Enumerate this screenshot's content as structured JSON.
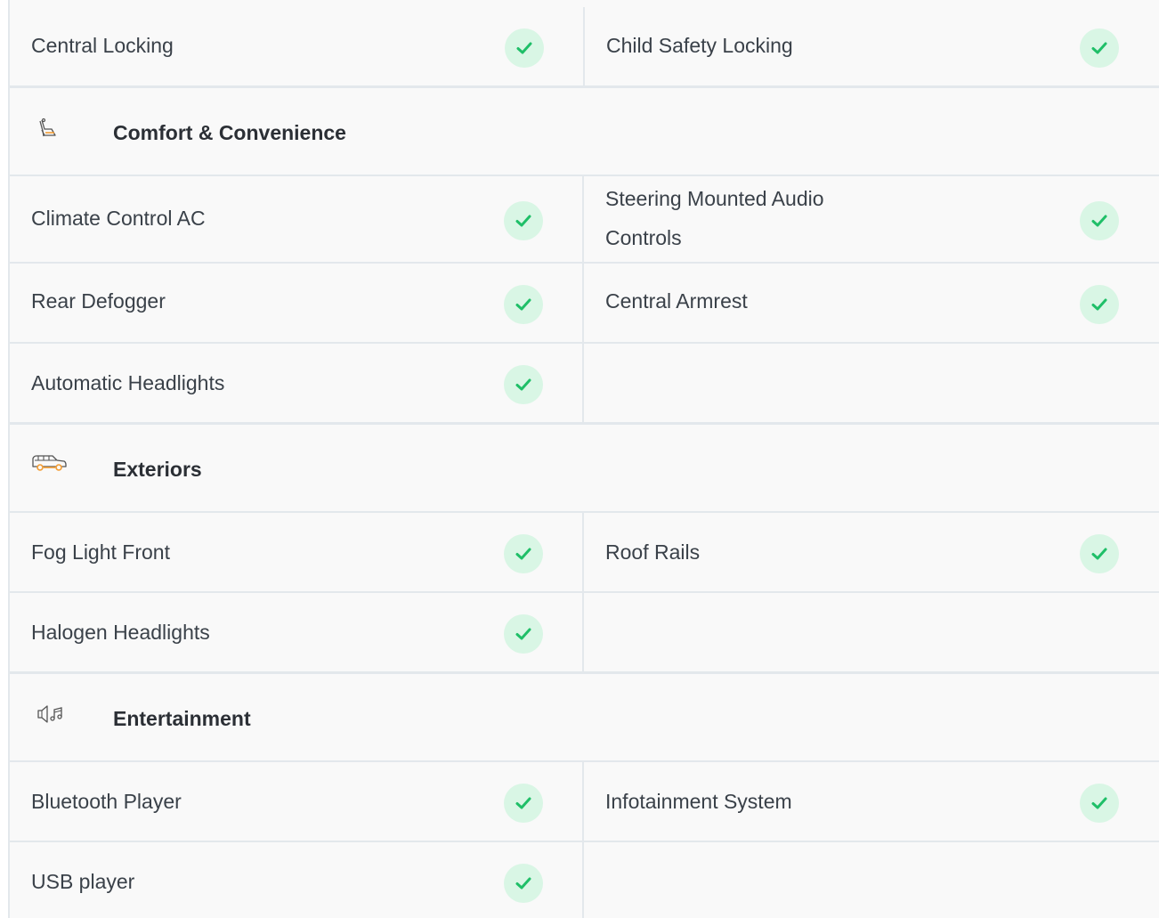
{
  "features": {
    "top_row": {
      "left": "Central Locking",
      "right": "Child Safety Locking"
    },
    "comfort": {
      "title": "Comfort & Convenience",
      "icon": "seat-icon",
      "items": [
        "Climate Control AC",
        "Steering Mounted Audio",
        "Controls",
        "Rear Defogger",
        "Central Armrest",
        "Automatic Headlights"
      ]
    },
    "exteriors": {
      "title": "Exteriors",
      "icon": "car-icon",
      "items": [
        "Fog Light Front",
        "Roof Rails",
        "Halogen Headlights"
      ]
    },
    "entertainment": {
      "title": "Entertainment",
      "icon": "speaker-music-icon",
      "items": [
        "Bluetooth Player",
        "Infotainment System",
        "USB player"
      ]
    }
  },
  "colors": {
    "check_bg": "#d9f6e5",
    "check_mark": "#1fbf68",
    "row_bg": "#f9f9f9",
    "divider": "#e3e8ec",
    "icon_accent": "#f39c32"
  }
}
